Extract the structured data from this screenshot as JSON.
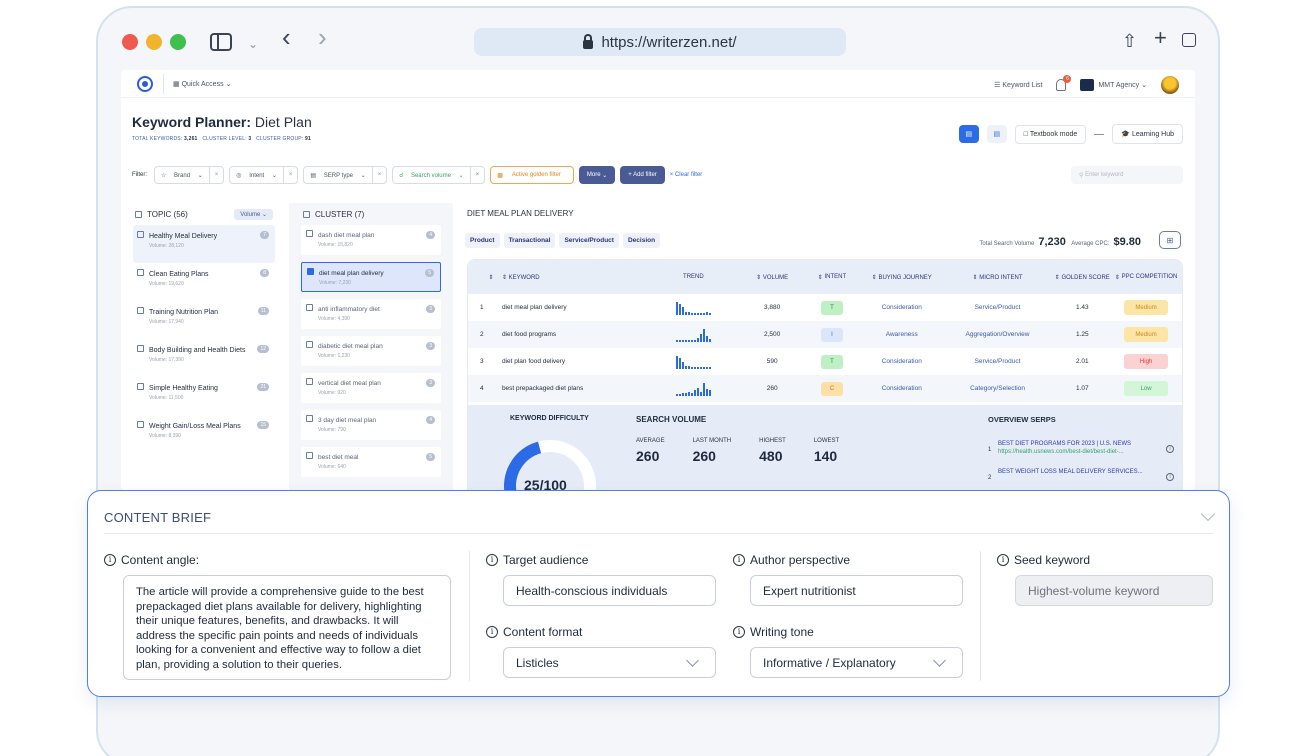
{
  "browser": {
    "url": "https://writerzen.net/"
  },
  "app": {
    "nav": {
      "quick_access": "Quick Access",
      "keyword_list": "Keyword List",
      "notification_count": "6",
      "agency": "MMT Agency"
    },
    "header": {
      "title_bold": "Keyword Planner:",
      "title_light": "Diet Plan",
      "total_keywords_label": "TOTAL KEYWORDS:",
      "total_keywords": "3,261",
      "cluster_level_label": "CLUSTER LEVEL:",
      "cluster_level": "3",
      "cluster_group_label": "CLUSTER GROUP:",
      "cluster_group": "91",
      "textbook_mode": "Textbook mode",
      "learning_hub": "Learning Hub"
    },
    "filters": {
      "label": "Filter:",
      "brand": "Brand",
      "intent": "Intent",
      "serp_type": "SERP type",
      "search_volume": "Search volume",
      "golden": "Active golden filter",
      "more": "More",
      "add_filter": "+ Add filter",
      "clear_filter": "Clear filter",
      "search_placeholder": "Enter keyword"
    },
    "topics": {
      "header": "TOPIC (56)",
      "sort": "Volume",
      "items": [
        {
          "name": "Healthy Meal Delivery",
          "volume": "Volume: 28,120",
          "count": "7"
        },
        {
          "name": "Clean Eating Plans",
          "volume": "Volume: 19,620",
          "count": "8"
        },
        {
          "name": "Training Nutrition Plan",
          "volume": "Volume: 17,940",
          "count": "11"
        },
        {
          "name": "Body Building and Health Diets",
          "volume": "Volume: 17,390",
          "count": "12"
        },
        {
          "name": "Simple Healthy Eating",
          "volume": "Volume: 11,500",
          "count": "21"
        },
        {
          "name": "Weight Gain/Loss Meal Plans",
          "volume": "Volume: 8,390",
          "count": "15"
        }
      ]
    },
    "clusters": {
      "header": "CLUSTER (7)",
      "items": [
        {
          "name": "dash diet meal plan",
          "volume": "Volume: 15,820",
          "count": "4"
        },
        {
          "name": "diet meal plan delivery",
          "volume": "Volume: 7,230",
          "count": "5"
        },
        {
          "name": "anti inflammatory diet",
          "volume": "Volume: 4,390",
          "count": "3"
        },
        {
          "name": "diabetic diet meal plan",
          "volume": "Volume: 1,230",
          "count": "3"
        },
        {
          "name": "vertical diet meal plan",
          "volume": "Volume: 920",
          "count": "3"
        },
        {
          "name": "3 day diet meal plan",
          "volume": "Volume: 790",
          "count": "4"
        },
        {
          "name": "best diet meal",
          "volume": "Volume: 640",
          "count": "5"
        }
      ]
    },
    "detail": {
      "title": "DIET MEAL PLAN DELIVERY",
      "tags": [
        "Product",
        "Transactional",
        "Service/Product",
        "Decision"
      ],
      "total_search_volume_label": "Total Search Volume",
      "total_search_volume": "7,230",
      "avg_cpc_label": "Average CPC:",
      "avg_cpc": "$9.80",
      "columns": [
        "KEYWORD",
        "TREND",
        "VOLUME",
        "INTENT",
        "BUYING JOURNEY",
        "MICRO INTENT",
        "GOLDEN SCORE",
        "PPC COMPETITION"
      ],
      "rows": [
        {
          "n": "1",
          "keyword": "diet meal plan delivery",
          "trend": [
            10,
            8,
            6,
            2,
            2,
            1,
            1,
            1,
            1,
            1,
            2,
            1
          ],
          "volume": "3,880",
          "intent": "T",
          "journey": "Consideration",
          "micro": "Service/Product",
          "golden": "1.43",
          "ppc": "Medium"
        },
        {
          "n": "2",
          "keyword": "diet food programs",
          "trend": [
            1,
            1,
            1,
            1,
            1,
            1,
            1,
            3,
            6,
            10,
            4,
            2
          ],
          "volume": "2,500",
          "intent": "I",
          "journey": "Awareness",
          "micro": "Aggregation/Overview",
          "golden": "1.25",
          "ppc": "Medium"
        },
        {
          "n": "3",
          "keyword": "diet plan food delivery",
          "trend": [
            10,
            8,
            5,
            2,
            2,
            1,
            1,
            1,
            1,
            1,
            1,
            1
          ],
          "volume": "590",
          "intent": "T",
          "journey": "Consideration",
          "micro": "Service/Product",
          "golden": "2.01",
          "ppc": "High"
        },
        {
          "n": "4",
          "keyword": "best prepackaged diet plans",
          "trend": [
            1,
            1,
            2,
            2,
            3,
            2,
            4,
            6,
            3,
            10,
            5,
            4
          ],
          "volume": "260",
          "intent": "C",
          "journey": "Consideration",
          "micro": "Category/Selection",
          "golden": "1.07",
          "ppc": "Low"
        }
      ],
      "overview": {
        "kd_title": "KEYWORD DIFFICULTY",
        "kd_value": "25/100",
        "kd_fraction": 0.25,
        "sv_title": "SEARCH VOLUME",
        "sv": [
          {
            "label": "AVERAGE",
            "value": "260"
          },
          {
            "label": "LAST MONTH",
            "value": "260"
          },
          {
            "label": "HIGHEST",
            "value": "480"
          },
          {
            "label": "LOWEST",
            "value": "140"
          }
        ],
        "serp_title": "OVERVIEW SERPS",
        "serps": [
          {
            "n": "1",
            "title": "BEST DIET PROGRAMS FOR 2023 | U.S. NEWS",
            "url": "https://health.usnews.com/best-diet/best-diet-..."
          },
          {
            "n": "2",
            "title": "BEST WEIGHT LOSS MEAL DELIVERY SERVICES..."
          }
        ]
      }
    }
  },
  "brief": {
    "title": "CONTENT BRIEF",
    "content_angle_label": "Content angle:",
    "content_angle": "The article will provide a comprehensive guide to the best prepackaged diet plans available for delivery, highlighting their unique features, benefits, and drawbacks. It will address the specific pain points and needs of individuals looking for a convenient and effective way to follow a diet plan, providing a solution to their queries.",
    "target_audience_label": "Target audience",
    "target_audience": "Health-conscious individuals",
    "author_perspective_label": "Author perspective",
    "author_perspective": "Expert nutritionist",
    "seed_keyword_label": "Seed keyword",
    "seed_keyword": "Highest-volume keyword",
    "content_format_label": "Content format",
    "content_format": "Listicles",
    "writing_tone_label": "Writing tone",
    "writing_tone": "Informative / Explanatory"
  },
  "colors": {
    "accent": "#2c6be6",
    "brief_border": "#4f7ee8"
  }
}
